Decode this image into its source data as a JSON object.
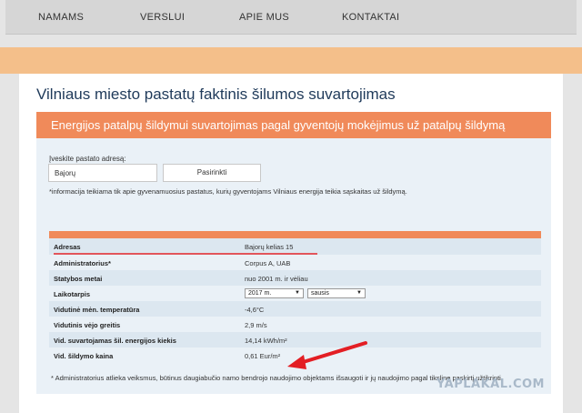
{
  "nav": {
    "items": [
      {
        "label": "NAMAMS"
      },
      {
        "label": "VERSLUI"
      },
      {
        "label": "APIE MUS"
      },
      {
        "label": "KONTAKTAI"
      }
    ]
  },
  "page": {
    "title": "Vilniaus miesto pastatų faktinis šilumos suvartojimas"
  },
  "panel": {
    "title": "Energijos patalpų šildymui suvartojimas pagal gyventojų mokėjimus už patalpų šildymą",
    "address_label": "Įveskite pastato adresą:",
    "address_value": "Bajorų",
    "select_button": "Pasirinkti",
    "info_note": "*informacija teikiama tik apie gyvenamuosius pastatus, kurių gyventojams Vilniaus energija teikia sąskaitas už šildymą."
  },
  "table": {
    "rows": [
      {
        "label": "Adresas",
        "value": "Bajorų kelias 15"
      },
      {
        "label": "Administratorius*",
        "value": "Corpus A, UAB"
      },
      {
        "label": "Statybos metai",
        "value": "nuo 2001 m. ir vėliau"
      },
      {
        "label": "Laikotarpis",
        "year": "2017 m.",
        "month": "sausis"
      },
      {
        "label": "Vidutinė mėn. temperatūra",
        "value": "-4,6°C"
      },
      {
        "label": "Vidutinis vėjo greitis",
        "value": "2,9 m/s"
      },
      {
        "label": "Vid. suvartojamas šil. energijos kiekis",
        "value": "14,14 kWh/m²"
      },
      {
        "label": "Vid. šildymo kaina",
        "value": "0,61 Eur/m²"
      }
    ]
  },
  "footnote": "* Administratorius atlieka veiksmus, būtinus daugiabučio namo bendrojo naudojimo objektams išsaugoti ir jų naudojimo pagal tikslinę paskirtį užtikrinti.",
  "watermark": "YAPLAKAL.COM",
  "colors": {
    "accent_orange": "#f08a5a",
    "band_orange": "#f4bf8a",
    "title_blue": "#1f3a5a",
    "panel_bg": "#eaf1f7",
    "arrow_red": "#e31e24"
  },
  "icons": {
    "dropdown": "chevron-down-icon",
    "annotation": "red-arrow-icon"
  }
}
